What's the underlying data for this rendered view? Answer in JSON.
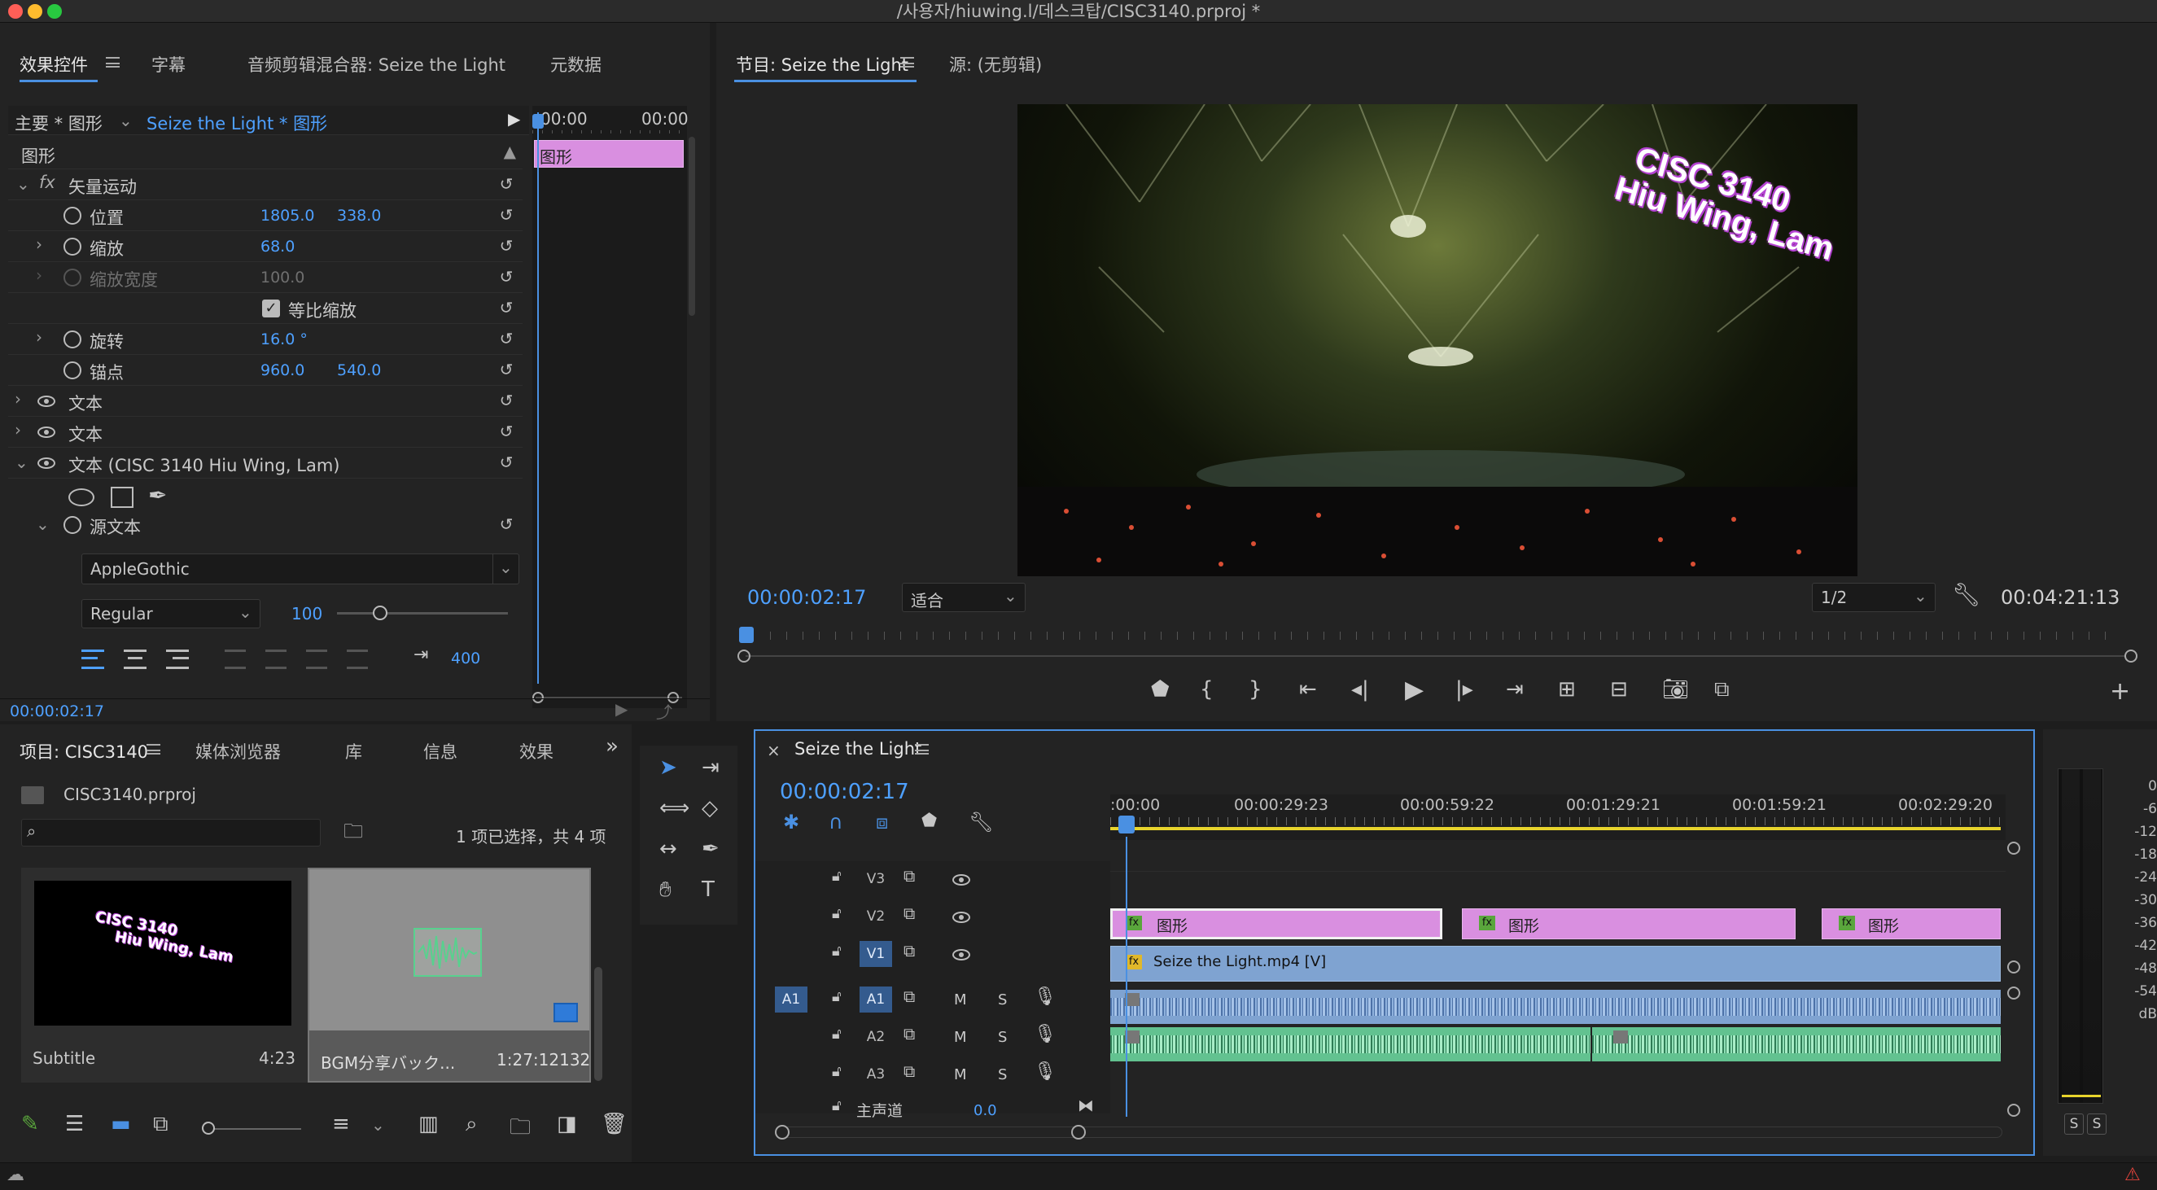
{
  "window": {
    "title": "/사용자/hiuwing.l/데스크탑/CISC3140.prproj *"
  },
  "effect_controls": {
    "tabs": [
      "效果控件",
      "字幕",
      "音频剪辑混合器: Seize the Light",
      "元数据"
    ],
    "master_clip": "主要 * 图形",
    "sequence_clip": "Seize the Light * 图形",
    "section": "图形",
    "timeline_time_a": "00:00",
    "timeline_time_b": "00:00",
    "clip_label": "图形",
    "vector_motion": "矢量运动",
    "position_label": "位置",
    "position_x": "1805.0",
    "position_y": "338.0",
    "scale_label": "缩放",
    "scale_value": "68.0",
    "scale_width_label": "缩放宽度",
    "scale_width_value": "100.0",
    "uniform_scale": "等比缩放",
    "rotation_label": "旋转",
    "rotation_value": "16.0 °",
    "anchor_label": "锚点",
    "anchor_x": "960.0",
    "anchor_y": "540.0",
    "text1": "文本",
    "text2": "文本",
    "text3": "文本 (CISC 3140 Hiu Wing, Lam)",
    "source_text": "源文本",
    "font_name": "AppleGothic",
    "font_style": "Regular",
    "font_size": "100",
    "tracking_value": "400",
    "current_time": "00:00:02:17"
  },
  "program_monitor": {
    "tabs": [
      "节目: Seize the Light",
      "源: (无剪辑)"
    ],
    "overlay_line1": "CISC 3140",
    "overlay_line2": "Hiu Wing, Lam",
    "timecode": "00:00:02:17",
    "fit_select": "适合",
    "resolution_select": "1/2",
    "duration": "00:04:21:13"
  },
  "project_panel": {
    "tabs": [
      "项目: CISC3140",
      "媒体浏览器",
      "库",
      "信息",
      "效果"
    ],
    "project_file": "CISC3140.prproj",
    "selection_info": "1 项已选择，共 4 项",
    "search_placeholder": "",
    "items": [
      {
        "name": "Subtitle",
        "duration": "4:23",
        "thumb_line1": "CISC 3140",
        "thumb_line2": "Hiu Wing, Lam"
      },
      {
        "name": "BGM分享バック...",
        "duration": "1:27:12132"
      }
    ]
  },
  "timeline": {
    "tab": "Seize the Light",
    "timecode": "00:00:02:17",
    "ruler_labels": [
      ":00:00",
      "00:00:29:23",
      "00:00:59:22",
      "00:01:29:21",
      "00:01:59:21",
      "00:02:29:20"
    ],
    "tracks": {
      "v3": "V3",
      "v2": "V2",
      "v1": "V1",
      "a1_src": "A1",
      "a1": "A1",
      "a2": "A2",
      "a3": "A3",
      "m": "M",
      "s": "S",
      "master": "主声道",
      "master_value": "0.0"
    },
    "clips": {
      "graphic": "图形",
      "video": "Seize the Light.mp4 [V]",
      "fx": "fx"
    }
  },
  "audio_meter": {
    "labels": [
      "0",
      "-6",
      "-12",
      "-18",
      "-24",
      "-30",
      "-36",
      "-42",
      "-48",
      "-54",
      "dB"
    ],
    "solo_l": "S",
    "solo_r": "S"
  },
  "colors": {
    "accent": "#4a90e2",
    "graphic_clip": "#d98fe0",
    "video_clip": "#7fa3d1",
    "audio_clip": "#62c290",
    "playhead": "#4a90e2"
  }
}
